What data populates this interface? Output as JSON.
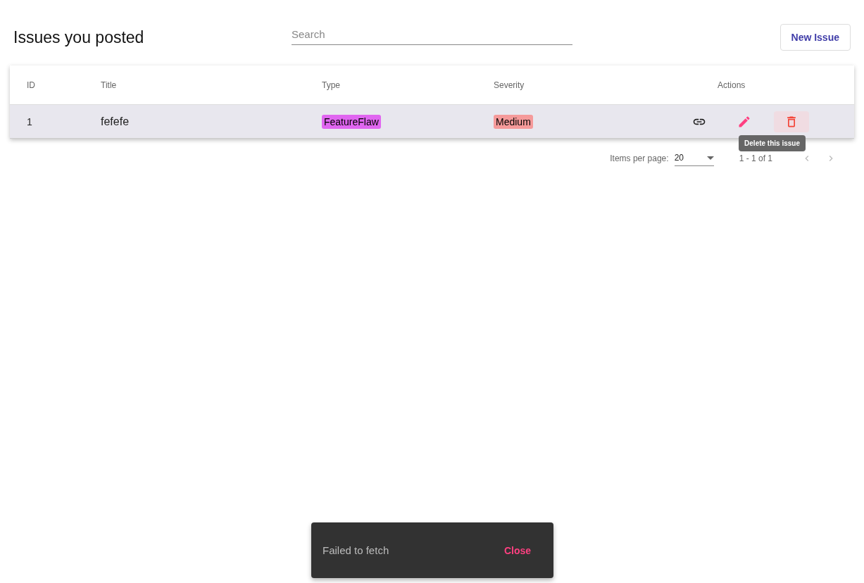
{
  "page_title": "Issues you posted",
  "search": {
    "placeholder": "Search"
  },
  "new_issue_button": "New Issue",
  "table": {
    "columns": [
      "ID",
      "Title",
      "Type",
      "Severity",
      "Actions"
    ],
    "rows": [
      {
        "id": "1",
        "title": "fefefe",
        "type": {
          "label": "FeatureFlaw",
          "color": "#e066f0"
        },
        "severity": {
          "label": "Medium",
          "color": "#f59a9a"
        },
        "delete_hovered": true
      }
    ]
  },
  "tooltip": "Delete this issue",
  "pagination": {
    "items_per_page_label": "Items per page:",
    "items_per_page": "20",
    "range": "1 - 1 of 1",
    "prev_disabled": true,
    "next_disabled": true
  },
  "snackbar": {
    "message": "Failed to fetch",
    "action": "Close"
  }
}
